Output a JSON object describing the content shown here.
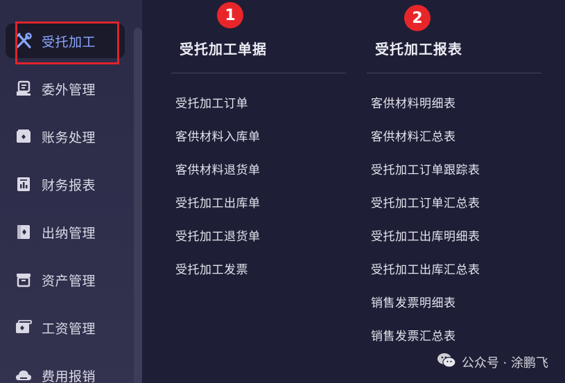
{
  "sidebar": {
    "items": [
      {
        "label": "受托加工",
        "icon": "tools-icon",
        "active": true
      },
      {
        "label": "委外管理",
        "icon": "document-hand-icon"
      },
      {
        "label": "账务处理",
        "icon": "box-icon"
      },
      {
        "label": "财务报表",
        "icon": "report-icon"
      },
      {
        "label": "出纳管理",
        "icon": "cash-icon"
      },
      {
        "label": "资产管理",
        "icon": "archive-icon"
      },
      {
        "label": "工资管理",
        "icon": "wallet-icon"
      },
      {
        "label": "费用报销",
        "icon": "cloud-icon"
      }
    ]
  },
  "columns": [
    {
      "badge": "1",
      "title": "受托加工单据",
      "links": [
        "受托加工订单",
        "客供材料入库单",
        "客供材料退货单",
        "受托加工出库单",
        "受托加工退货单",
        "受托加工发票"
      ]
    },
    {
      "badge": "2",
      "title": "受托加工报表",
      "links": [
        "客供材料明细表",
        "客供材料汇总表",
        "受托加工订单跟踪表",
        "受托加工订单汇总表",
        "受托加工出库明细表",
        "受托加工出库汇总表",
        "销售发票明细表",
        "销售发票汇总表"
      ]
    }
  ],
  "watermark": {
    "text": "公众号 · 涂鹏飞",
    "icon": "wechat-icon"
  },
  "colors": {
    "active": "#8aa6ff",
    "badge": "#e8262a",
    "highlight": "#e0242b",
    "background": "#1e1f36"
  }
}
